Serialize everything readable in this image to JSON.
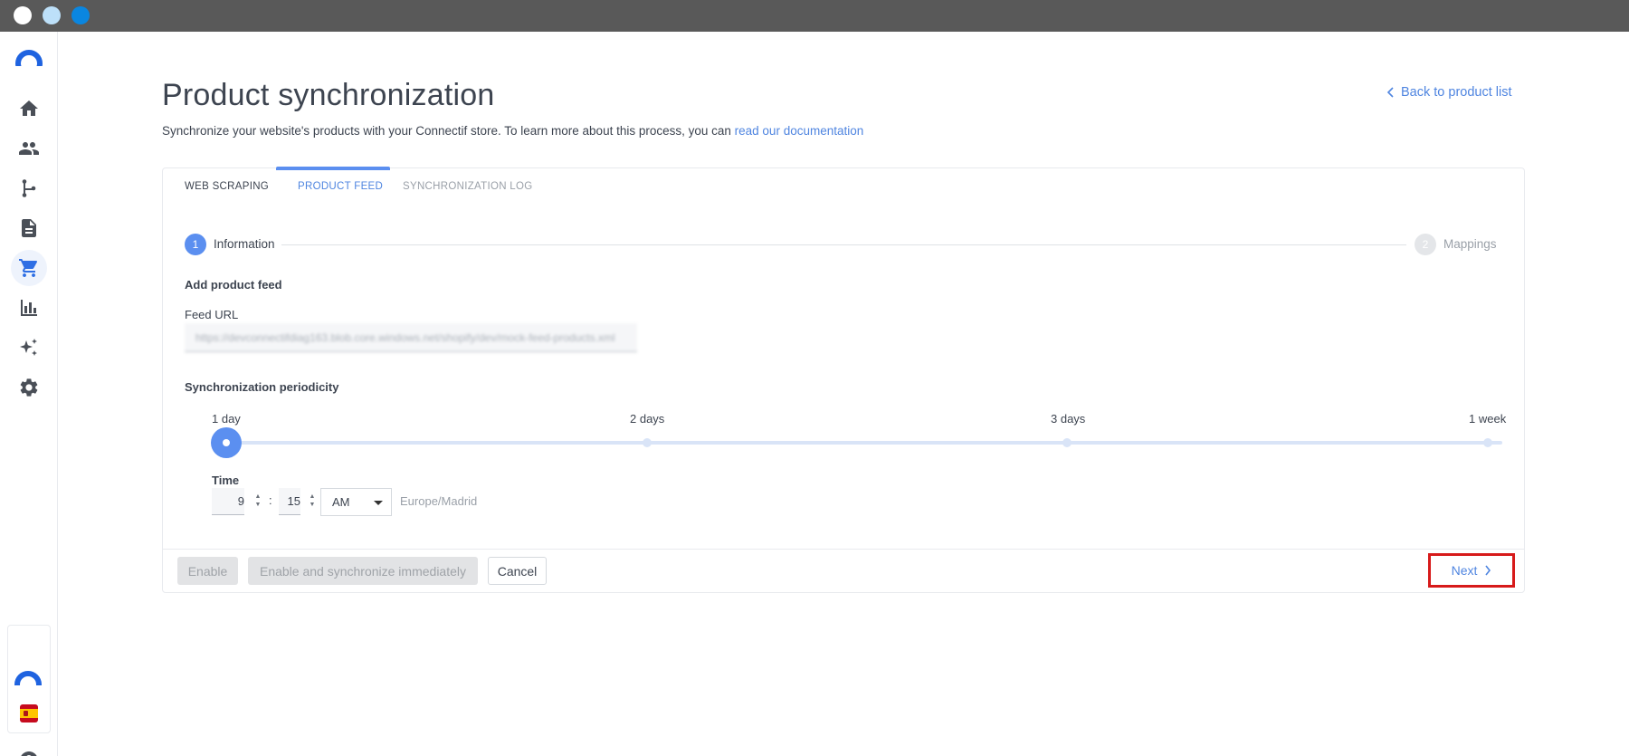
{
  "chrome": {
    "dots": [
      "#ffffff",
      "#bde0f9",
      "#0a86e0"
    ]
  },
  "sidebar": {
    "items": [
      {
        "name": "home-icon",
        "active": false
      },
      {
        "name": "people-icon",
        "active": false
      },
      {
        "name": "workflow-icon",
        "active": false
      },
      {
        "name": "document-icon",
        "active": false
      },
      {
        "name": "cart-icon",
        "active": true
      },
      {
        "name": "bar-chart-icon",
        "active": false
      },
      {
        "name": "sparkles-icon",
        "active": false
      },
      {
        "name": "gear-icon",
        "active": false
      }
    ]
  },
  "header": {
    "title": "Product synchronization",
    "back_link": "Back to product list",
    "subtitle_prefix": "Synchronize your website's products with your Connectif store. To learn more about this process, you can ",
    "subtitle_link": "read our documentation"
  },
  "tabs": [
    {
      "label": "WEB SCRAPING",
      "active": false
    },
    {
      "label": "PRODUCT FEED",
      "active": true
    },
    {
      "label": "SYNCHRONIZATION LOG",
      "active": false
    }
  ],
  "stepper": {
    "steps": [
      {
        "number": "1",
        "label": "Information",
        "active": true
      },
      {
        "number": "2",
        "label": "Mappings",
        "active": false
      }
    ]
  },
  "form": {
    "section_title": "Add product feed",
    "feed_url_label": "Feed URL",
    "feed_url_value": "https://devconnectifdiag163.blob.core.windows.net/shopify/dev/mock-feed-products.xml",
    "periodicity_title": "Synchronization periodicity",
    "periodicity_options": [
      "1 day",
      "2 days",
      "3 days",
      "1 week"
    ],
    "periodicity_selected": "1 day",
    "time_label": "Time",
    "time_hour": "9",
    "time_minute": "15",
    "time_colon": ":",
    "time_ampm": "AM",
    "timezone": "Europe/Madrid"
  },
  "footer": {
    "enable_label": "Enable",
    "enable_sync_label": "Enable and synchronize immediately",
    "cancel_label": "Cancel",
    "next_label": "Next"
  }
}
